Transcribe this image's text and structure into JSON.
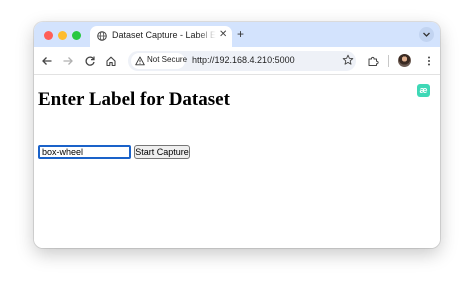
{
  "browser": {
    "tab": {
      "title": "Dataset Capture - Label Entry",
      "close_glyph": "✕",
      "icon": "globe-icon"
    },
    "new_tab_glyph": "+",
    "address_bar": {
      "security_label": "Not Secure",
      "url": "http://192.168.4.210:5000"
    },
    "icons": [
      "back-arrow-icon",
      "forward-arrow-icon",
      "reload-icon",
      "home-icon",
      "warning-icon",
      "bookmark-star-icon",
      "extensions-icon",
      "profile-avatar",
      "more-menu-icon",
      "tab-search-icon"
    ]
  },
  "page": {
    "heading": "Enter Label for Dataset",
    "label_input": {
      "value": "box-wheel",
      "placeholder": ""
    },
    "capture_button_label": "Start Capture",
    "extension_icon_text": "æ"
  },
  "colors": {
    "tabbar": "#d3e3fd",
    "input_focus": "#1a62c9",
    "extension_accent": "#3ed8b6"
  }
}
